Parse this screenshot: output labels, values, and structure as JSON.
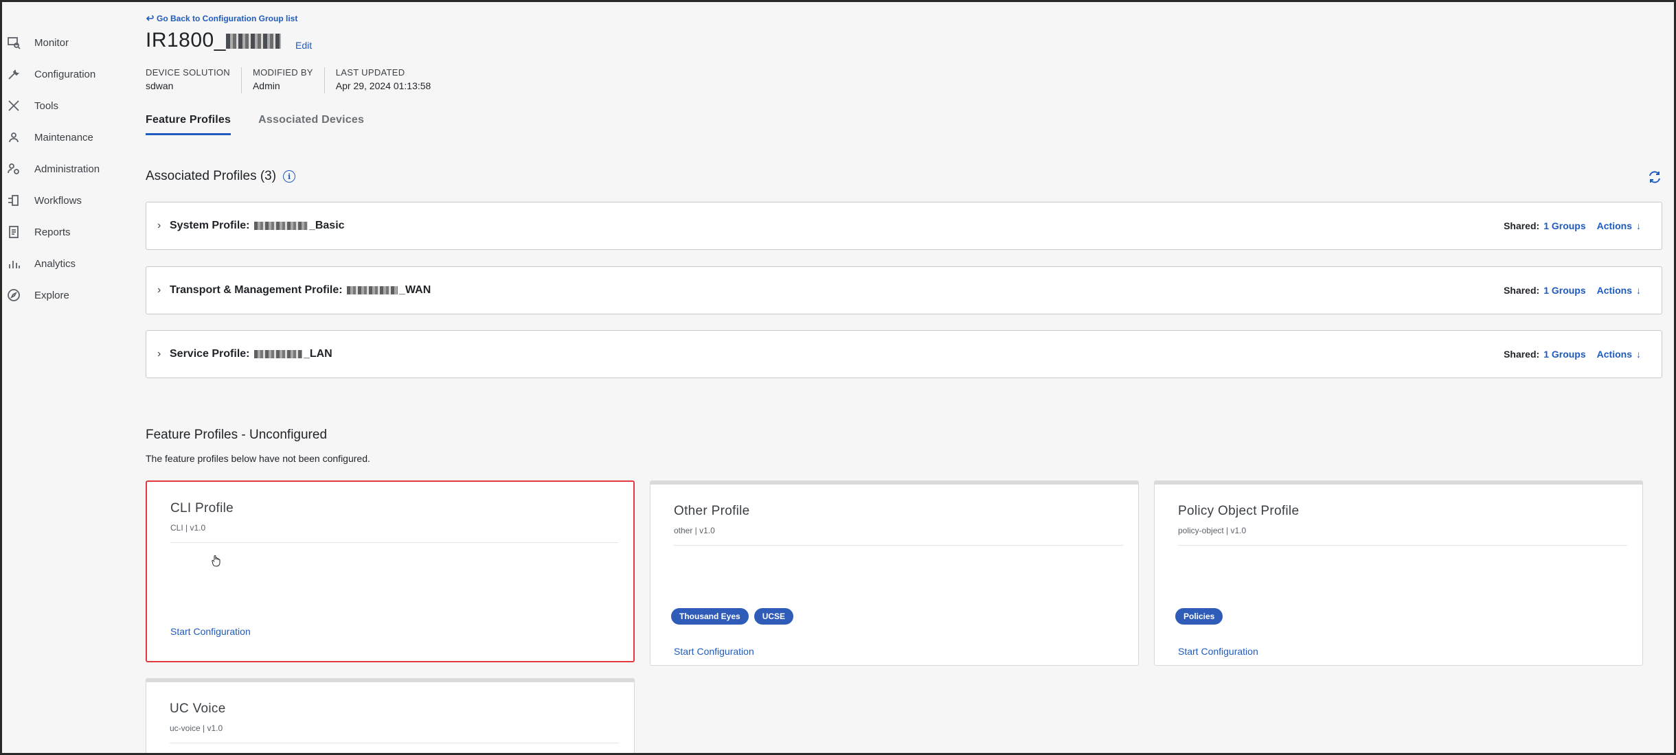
{
  "sidebar": {
    "items": [
      {
        "label": "Monitor",
        "icon": "monitor-icon"
      },
      {
        "label": "Configuration",
        "icon": "wrench-icon"
      },
      {
        "label": "Tools",
        "icon": "tools-icon"
      },
      {
        "label": "Maintenance",
        "icon": "maintenance-icon"
      },
      {
        "label": "Administration",
        "icon": "admin-icon"
      },
      {
        "label": "Workflows",
        "icon": "workflows-icon"
      },
      {
        "label": "Reports",
        "icon": "reports-icon"
      },
      {
        "label": "Analytics",
        "icon": "analytics-icon"
      },
      {
        "label": "Explore",
        "icon": "compass-icon"
      }
    ]
  },
  "header": {
    "back_link": "Go Back to Configuration Group list",
    "title": "IR1800_",
    "edit": "Edit",
    "meta": [
      {
        "label": "DEVICE SOLUTION",
        "value": "sdwan"
      },
      {
        "label": "MODIFIED BY",
        "value": "Admin"
      },
      {
        "label": "LAST UPDATED",
        "value": "Apr 29, 2024 01:13:58"
      }
    ]
  },
  "tabs": [
    "Feature Profiles",
    "Associated Devices"
  ],
  "associated": {
    "title": "Associated Profiles (3)",
    "profiles": [
      {
        "type": "System Profile:",
        "suffix": "_Basic",
        "shared_label": "Shared:",
        "groups": "1 Groups",
        "actions": "Actions"
      },
      {
        "type": "Transport & Management Profile:",
        "suffix": "_WAN",
        "shared_label": "Shared:",
        "groups": "1 Groups",
        "actions": "Actions"
      },
      {
        "type": "Service Profile:",
        "suffix": "_LAN",
        "shared_label": "Shared:",
        "groups": "1 Groups",
        "actions": "Actions"
      }
    ]
  },
  "unconfigured": {
    "title": "Feature Profiles - Unconfigured",
    "description": "The feature profiles below have not been configured.",
    "cards": [
      {
        "title": "CLI Profile",
        "sub": "CLI | v1.0",
        "tags": [],
        "start": "Start Configuration"
      },
      {
        "title": "Other Profile",
        "sub": "other | v1.0",
        "tags": [
          "Thousand Eyes",
          "UCSE"
        ],
        "start": "Start Configuration"
      },
      {
        "title": "Policy Object Profile",
        "sub": "policy-object | v1.0",
        "tags": [
          "Policies"
        ],
        "start": "Start Configuration"
      },
      {
        "title": "UC Voice",
        "sub": "uc-voice | v1.0",
        "tags": [],
        "start": ""
      }
    ]
  },
  "colors": {
    "accent": "#1f5bbf",
    "tag": "#2e5cb8",
    "selected_border": "#e0393e"
  }
}
